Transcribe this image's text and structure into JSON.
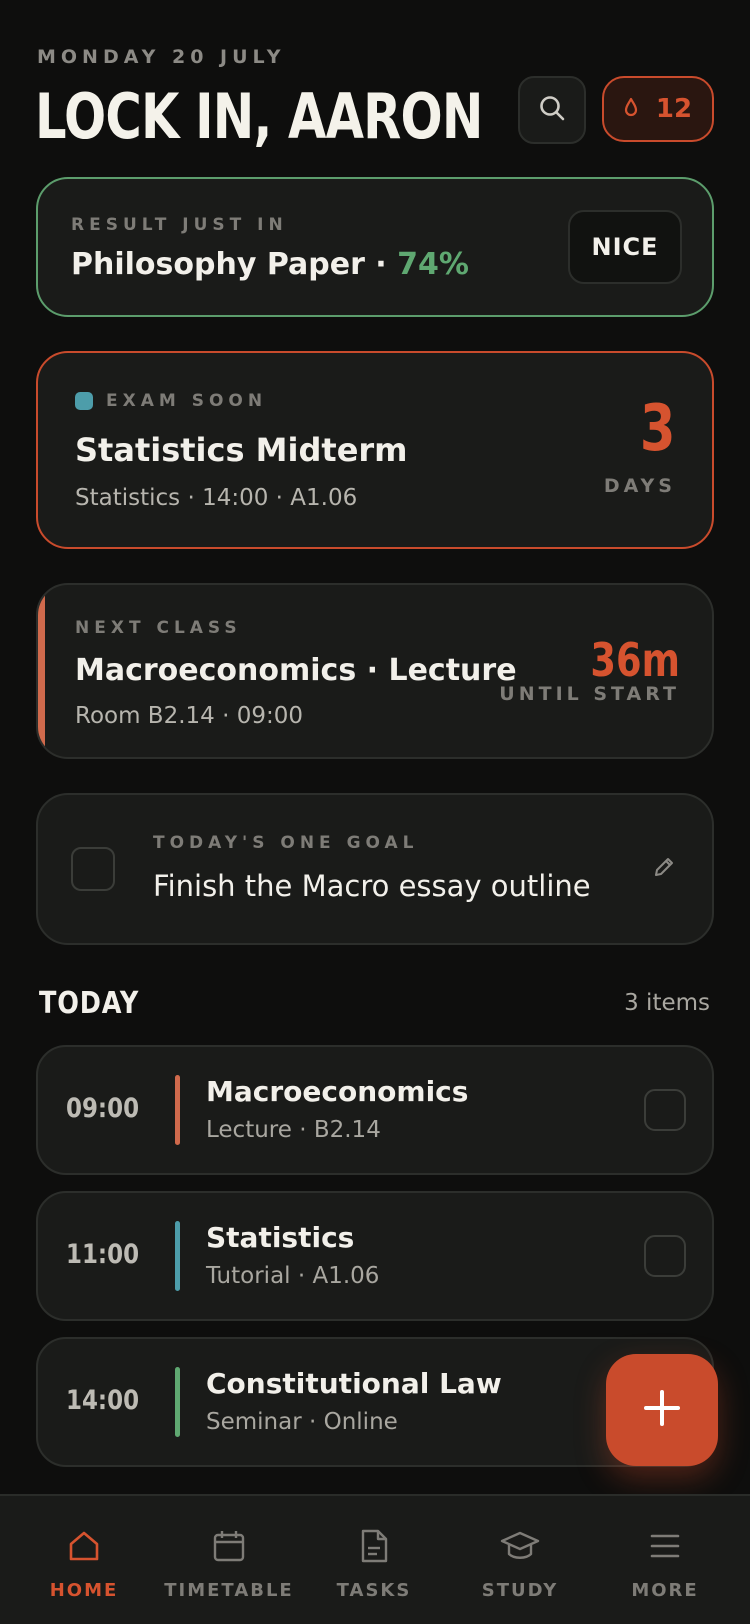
{
  "header": {
    "date": "MONDAY 20 JULY",
    "greeting": "LOCK IN, AARON",
    "streak_count": "12",
    "search_icon": "search-icon",
    "streak_icon": "flame-icon"
  },
  "result_card": {
    "label": "RESULT JUST IN",
    "title": "Philosophy Paper · ",
    "score": "74%",
    "button": "NICE"
  },
  "exam_card": {
    "label": "EXAM SOON",
    "title": "Statistics Midterm",
    "details": "Statistics · 14:00 · A1.06",
    "countdown_value": "3",
    "countdown_unit": "DAYS",
    "dot_color": "#4d9daa"
  },
  "next_class_card": {
    "label": "NEXT CLASS",
    "title": "Macroeconomics · Lecture",
    "details": "Room B2.14 · 09:00",
    "countdown_value": "36m",
    "countdown_unit": "UNTIL START"
  },
  "goal_card": {
    "label": "TODAY'S ONE GOAL",
    "text": "Finish the Macro essay outline"
  },
  "today": {
    "title": "TODAY",
    "count": "3 items",
    "items": [
      {
        "time": "09:00",
        "name": "Macroeconomics",
        "detail": "Lecture · B2.14",
        "color": "#d06a4c"
      },
      {
        "time": "11:00",
        "name": "Statistics",
        "detail": "Tutorial · A1.06",
        "color": "#4d9daa"
      },
      {
        "time": "14:00",
        "name": "Constitutional Law",
        "detail": "Seminar · Online",
        "color": "#5fa871"
      }
    ]
  },
  "nav": {
    "items": [
      {
        "label": "HOME",
        "icon": "home-icon",
        "active": true
      },
      {
        "label": "TIMETABLE",
        "icon": "calendar-icon",
        "active": false
      },
      {
        "label": "TASKS",
        "icon": "document-icon",
        "active": false
      },
      {
        "label": "STUDY",
        "icon": "graduation-cap-icon",
        "active": false
      },
      {
        "label": "MORE",
        "icon": "menu-icon",
        "active": false
      }
    ]
  },
  "colors": {
    "accent": "#d6532f",
    "success": "#5fa871",
    "background": "#0e0e0d",
    "card": "#1a1b19"
  }
}
